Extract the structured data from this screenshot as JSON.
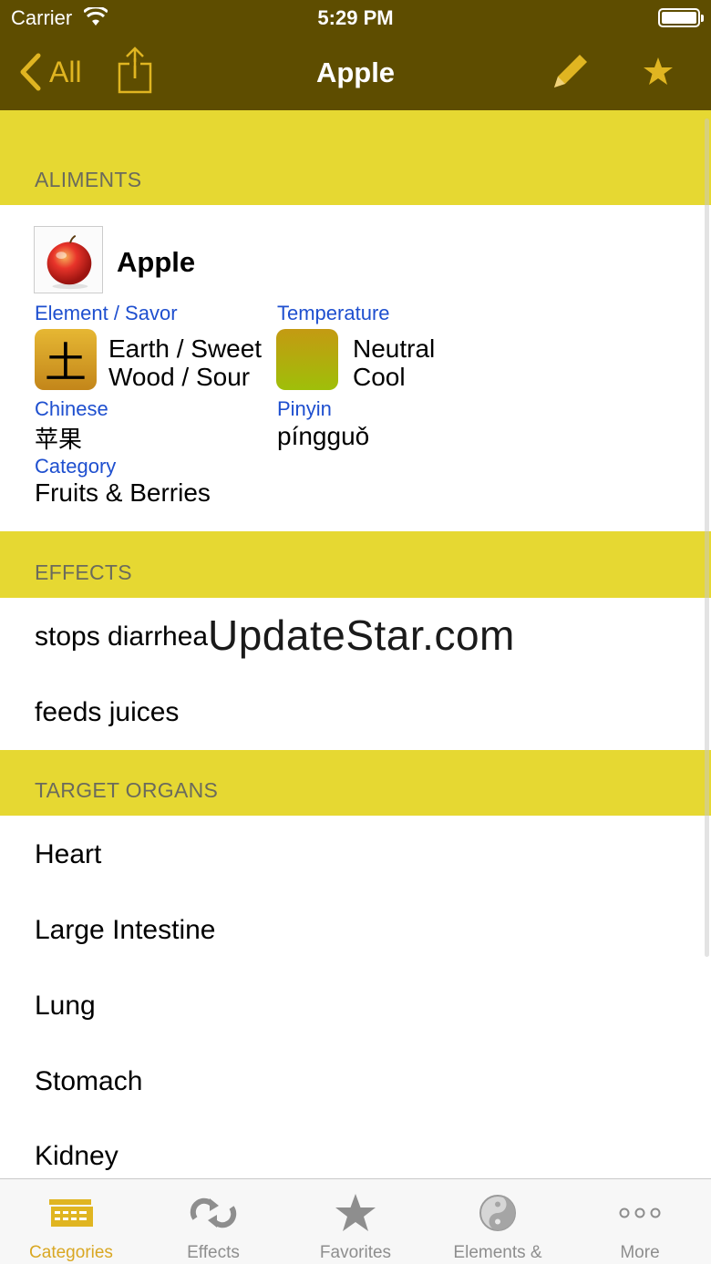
{
  "status": {
    "carrier": "Carrier",
    "time": "5:29 PM"
  },
  "nav": {
    "back_label": "All",
    "title": "Apple"
  },
  "sections": {
    "aliments": "ALIMENTS",
    "effects": "EFFECTS",
    "target_organs": "TARGET ORGANS"
  },
  "aliment": {
    "name": "Apple",
    "element_label": "Element / Savor",
    "element_glyph": "土",
    "element_lines": [
      "Earth / Sweet",
      "Wood / Sour"
    ],
    "temperature_label": "Temperature",
    "temperature_lines": [
      "Neutral",
      "Cool"
    ],
    "chinese_label": "Chinese",
    "chinese_value": "苹果",
    "pinyin_label": "Pinyin",
    "pinyin_value": "píngguǒ",
    "category_label": "Category",
    "category_value": "Fruits & Berries"
  },
  "effects": [
    "stops diarrhea",
    "feeds juices"
  ],
  "organs": [
    "Heart",
    "Large Intestine",
    "Lung",
    "Stomach",
    "Kidney"
  ],
  "watermark": "UpdateStar.com",
  "tabs": [
    {
      "label": "Categories",
      "icon": "categories-icon",
      "active": true
    },
    {
      "label": "Effects",
      "icon": "effects-icon",
      "active": false
    },
    {
      "label": "Favorites",
      "icon": "star-icon",
      "active": false
    },
    {
      "label": "Elements & Organs",
      "icon": "yin-yang-icon",
      "active": false
    },
    {
      "label": "More",
      "icon": "more-icon",
      "active": false
    }
  ],
  "colors": {
    "nav_bg": "#5e4d00",
    "accent": "#e0b521",
    "section_bg": "#e6d832",
    "link_blue": "#1e4fcf"
  }
}
